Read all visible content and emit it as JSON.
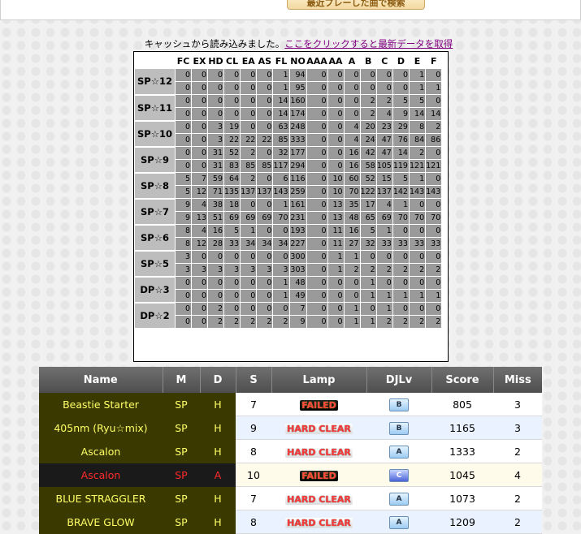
{
  "top": {
    "recent_button_label": "最近プレーした曲で検索"
  },
  "cache": {
    "message": "キャッシュから読み込みました。",
    "link_label": "ここをクリックすると最新データを取得"
  },
  "stats": {
    "columns": [
      "FC",
      "EX",
      "HD",
      "CL",
      "EA",
      "AS",
      "FL",
      "NO",
      "AAA",
      "AA",
      "A",
      "B",
      "C",
      "D",
      "E",
      "F"
    ],
    "groups": [
      {
        "label": "SP☆12",
        "rows": [
          [
            "0",
            "0",
            "0",
            "0",
            "0",
            "0",
            "1",
            "94",
            "0",
            "0",
            "0",
            "0",
            "0",
            "0",
            "1",
            "0"
          ],
          [
            "0",
            "0",
            "0",
            "0",
            "0",
            "0",
            "1",
            "95",
            "0",
            "0",
            "0",
            "0",
            "0",
            "0",
            "1",
            "1"
          ]
        ]
      },
      {
        "label": "SP☆11",
        "rows": [
          [
            "0",
            "0",
            "0",
            "0",
            "0",
            "0",
            "14",
            "160",
            "0",
            "0",
            "0",
            "2",
            "2",
            "5",
            "5",
            "0"
          ],
          [
            "0",
            "0",
            "0",
            "0",
            "0",
            "0",
            "14",
            "174",
            "0",
            "0",
            "0",
            "2",
            "4",
            "9",
            "14",
            "14"
          ]
        ]
      },
      {
        "label": "SP☆10",
        "rows": [
          [
            "0",
            "0",
            "3",
            "19",
            "0",
            "0",
            "63",
            "248",
            "0",
            "0",
            "4",
            "20",
            "23",
            "29",
            "8",
            "2"
          ],
          [
            "0",
            "0",
            "3",
            "22",
            "22",
            "22",
            "85",
            "333",
            "0",
            "0",
            "4",
            "24",
            "47",
            "76",
            "84",
            "86"
          ]
        ]
      },
      {
        "label": "SP☆9",
        "rows": [
          [
            "0",
            "0",
            "31",
            "52",
            "2",
            "0",
            "32",
            "177",
            "0",
            "0",
            "16",
            "42",
            "47",
            "14",
            "2",
            "0"
          ],
          [
            "0",
            "0",
            "31",
            "83",
            "85",
            "85",
            "117",
            "294",
            "0",
            "0",
            "16",
            "58",
            "105",
            "119",
            "121",
            "121"
          ]
        ]
      },
      {
        "label": "SP☆8",
        "rows": [
          [
            "5",
            "7",
            "59",
            "64",
            "2",
            "0",
            "6",
            "116",
            "0",
            "10",
            "60",
            "52",
            "15",
            "5",
            "1",
            "0"
          ],
          [
            "5",
            "12",
            "71",
            "135",
            "137",
            "137",
            "143",
            "259",
            "0",
            "10",
            "70",
            "122",
            "137",
            "142",
            "143",
            "143"
          ]
        ]
      },
      {
        "label": "SP☆7",
        "rows": [
          [
            "9",
            "4",
            "38",
            "18",
            "0",
            "0",
            "1",
            "161",
            "0",
            "13",
            "35",
            "17",
            "4",
            "1",
            "0",
            "0"
          ],
          [
            "9",
            "13",
            "51",
            "69",
            "69",
            "69",
            "70",
            "231",
            "0",
            "13",
            "48",
            "65",
            "69",
            "70",
            "70",
            "70"
          ]
        ]
      },
      {
        "label": "SP☆6",
        "rows": [
          [
            "8",
            "4",
            "16",
            "5",
            "1",
            "0",
            "0",
            "193",
            "0",
            "11",
            "16",
            "5",
            "1",
            "0",
            "0",
            "0"
          ],
          [
            "8",
            "12",
            "28",
            "33",
            "34",
            "34",
            "34",
            "227",
            "0",
            "11",
            "27",
            "32",
            "33",
            "33",
            "33",
            "33"
          ]
        ]
      },
      {
        "label": "SP☆5",
        "rows": [
          [
            "3",
            "0",
            "0",
            "0",
            "0",
            "0",
            "0",
            "300",
            "0",
            "1",
            "1",
            "0",
            "0",
            "0",
            "0",
            "0"
          ],
          [
            "3",
            "3",
            "3",
            "3",
            "3",
            "3",
            "3",
            "303",
            "0",
            "1",
            "2",
            "2",
            "2",
            "2",
            "2",
            "2"
          ]
        ]
      },
      {
        "label": "DP☆3",
        "rows": [
          [
            "0",
            "0",
            "0",
            "0",
            "0",
            "0",
            "1",
            "48",
            "0",
            "0",
            "0",
            "1",
            "0",
            "0",
            "0",
            "0"
          ],
          [
            "0",
            "0",
            "0",
            "0",
            "0",
            "0",
            "1",
            "49",
            "0",
            "0",
            "0",
            "1",
            "1",
            "1",
            "1",
            "1"
          ]
        ]
      },
      {
        "label": "DP☆2",
        "rows": [
          [
            "0",
            "0",
            "2",
            "0",
            "0",
            "0",
            "0",
            "7",
            "0",
            "0",
            "1",
            "0",
            "1",
            "0",
            "0",
            "0"
          ],
          [
            "0",
            "0",
            "2",
            "2",
            "2",
            "2",
            "2",
            "9",
            "0",
            "0",
            "1",
            "1",
            "2",
            "2",
            "2",
            "2"
          ]
        ]
      }
    ]
  },
  "scores": {
    "headers": {
      "name": "Name",
      "m": "M",
      "d": "D",
      "s": "S",
      "lamp": "Lamp",
      "djlv": "DJLv",
      "score": "Score",
      "miss": "Miss"
    },
    "rows": [
      {
        "name": "Beastie Starter",
        "m": "SP",
        "d": "H",
        "s": "7",
        "lamp": "FAILED",
        "lamp_type": "failed",
        "djlv": "B",
        "score": "805",
        "miss": "3",
        "diff": "h"
      },
      {
        "name": "405nm (Ryu☆mix)",
        "m": "SP",
        "d": "H",
        "s": "9",
        "lamp": "HARD CLEAR",
        "lamp_type": "hard",
        "djlv": "B",
        "score": "1165",
        "miss": "3",
        "diff": "h"
      },
      {
        "name": "Ascalon",
        "m": "SP",
        "d": "H",
        "s": "8",
        "lamp": "HARD CLEAR",
        "lamp_type": "hard",
        "djlv": "A",
        "score": "1333",
        "miss": "2",
        "diff": "h"
      },
      {
        "name": "Ascalon",
        "m": "SP",
        "d": "A",
        "s": "10",
        "lamp": "FAILED",
        "lamp_type": "failed",
        "djlv": "C",
        "score": "1045",
        "miss": "4",
        "diff": "a"
      },
      {
        "name": "BLUE STRAGGLER",
        "m": "SP",
        "d": "H",
        "s": "7",
        "lamp": "HARD CLEAR",
        "lamp_type": "hard",
        "djlv": "A",
        "score": "1073",
        "miss": "2",
        "diff": "h"
      },
      {
        "name": "BRAVE GLOW",
        "m": "SP",
        "d": "H",
        "s": "8",
        "lamp": "HARD CLEAR",
        "lamp_type": "hard",
        "djlv": "A",
        "score": "1209",
        "miss": "2",
        "diff": "h"
      }
    ]
  },
  "colors": {
    "hyper_text": "#ffff66",
    "another_text": "#ff2a2a",
    "cell_grey": "#9a9a9a"
  }
}
